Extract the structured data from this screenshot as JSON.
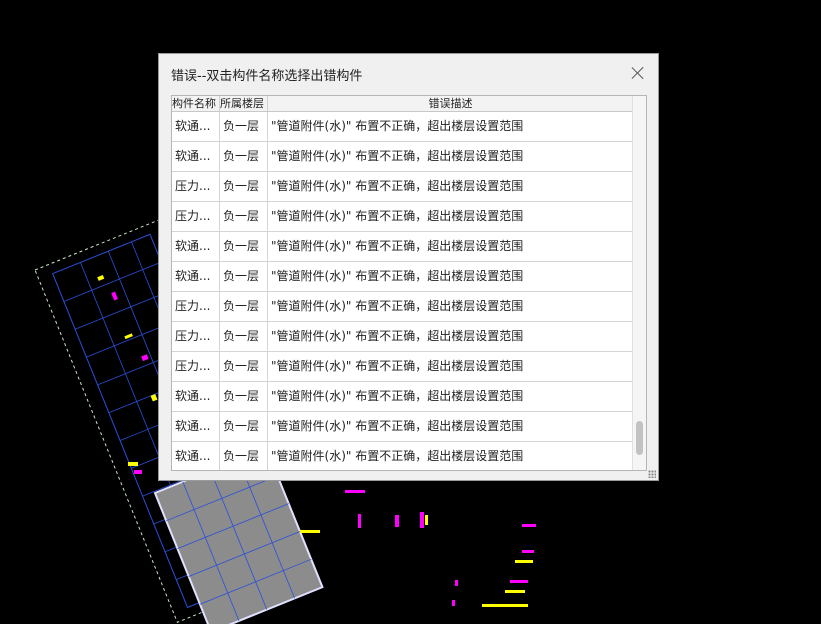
{
  "dialog": {
    "title": "错误--双击构件名称选择出错构件",
    "close_icon": "close-icon"
  },
  "table": {
    "columns": [
      "构件名称",
      "所属楼层",
      "错误描述"
    ],
    "rows": [
      [
        "软通...",
        "负一层",
        "\"管道附件(水)\" 布置不正确，超出楼层设置范围"
      ],
      [
        "软通...",
        "负一层",
        "\"管道附件(水)\" 布置不正确，超出楼层设置范围"
      ],
      [
        "压力...",
        "负一层",
        "\"管道附件(水)\" 布置不正确，超出楼层设置范围"
      ],
      [
        "压力...",
        "负一层",
        "\"管道附件(水)\" 布置不正确，超出楼层设置范围"
      ],
      [
        "软通...",
        "负一层",
        "\"管道附件(水)\" 布置不正确，超出楼层设置范围"
      ],
      [
        "软通...",
        "负一层",
        "\"管道附件(水)\" 布置不正确，超出楼层设置范围"
      ],
      [
        "压力...",
        "负一层",
        "\"管道附件(水)\" 布置不正确，超出楼层设置范围"
      ],
      [
        "压力...",
        "负一层",
        "\"管道附件(水)\" 布置不正确，超出楼层设置范围"
      ],
      [
        "压力...",
        "负一层",
        "\"管道附件(水)\" 布置不正确，超出楼层设置范围"
      ],
      [
        "软通...",
        "负一层",
        "\"管道附件(水)\" 布置不正确，超出楼层设置范围"
      ],
      [
        "软通...",
        "负一层",
        "\"管道附件(水)\" 布置不正确，超出楼层设置范围"
      ],
      [
        "软通...",
        "负一层",
        "\"管道附件(水)\" 布置不正确，超出楼层设置范围"
      ]
    ]
  },
  "colors": {
    "canvas_bg": "#000000",
    "grid_line": "#2a4fd8",
    "axis_line": "#c8e6c8",
    "magenta": "#ff00ff",
    "yellow": "#ffff00",
    "slab_fill": "#8c8c8c"
  }
}
